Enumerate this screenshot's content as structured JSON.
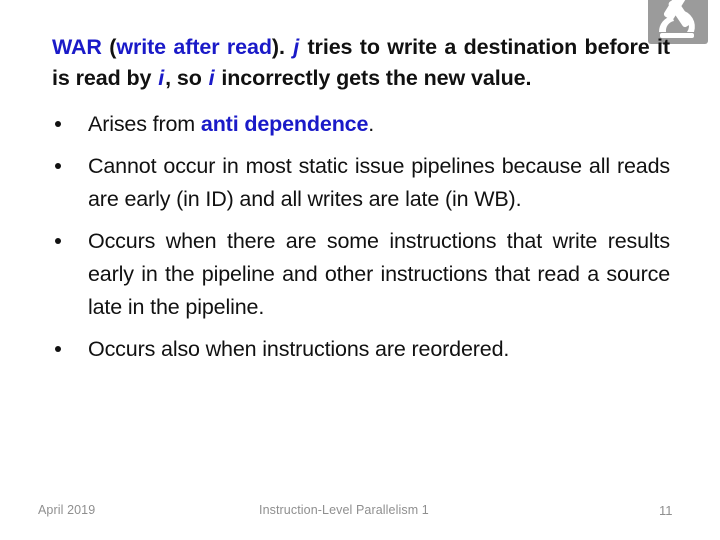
{
  "slide": {
    "logo": {
      "icon_name": "microscope-logo-icon",
      "background_color": "#9b9b9b",
      "glyph_color": "#ffffff"
    },
    "lead": {
      "term": "WAR",
      "open_paren": " (",
      "expansion": "write after read",
      "close_paren": ").",
      "text_1": " ",
      "var_j": "j",
      "text_2": " tries to write a destination before it is read by ",
      "var_i_1": "i",
      "text_3": ", so ",
      "var_i_2": "i",
      "text_4": " incorrectly gets the new value.",
      "accent_color": "#1a1ac8"
    },
    "bullets": [
      {
        "prefix": "Arises from ",
        "highlight": "anti dependence",
        "suffix": ".",
        "justify_last": false
      },
      {
        "prefix": "Cannot occur in most static issue pipelines because all reads are early (in ID) and all writes are late (in WB).",
        "highlight": "",
        "suffix": "",
        "justify_last": true
      },
      {
        "prefix": "Occurs when there are some instructions that write results early in the pipeline and other instructions that read a source late in the pipeline.",
        "highlight": "",
        "suffix": "",
        "justify_last": true
      },
      {
        "prefix": "Occurs also when instructions are reordered.",
        "highlight": "",
        "suffix": "",
        "justify_last": false
      }
    ],
    "footer": {
      "date": "April 2019",
      "title": "Instruction-Level Parallelism 1",
      "page_number": "11",
      "color": "#8f8f8f"
    }
  }
}
